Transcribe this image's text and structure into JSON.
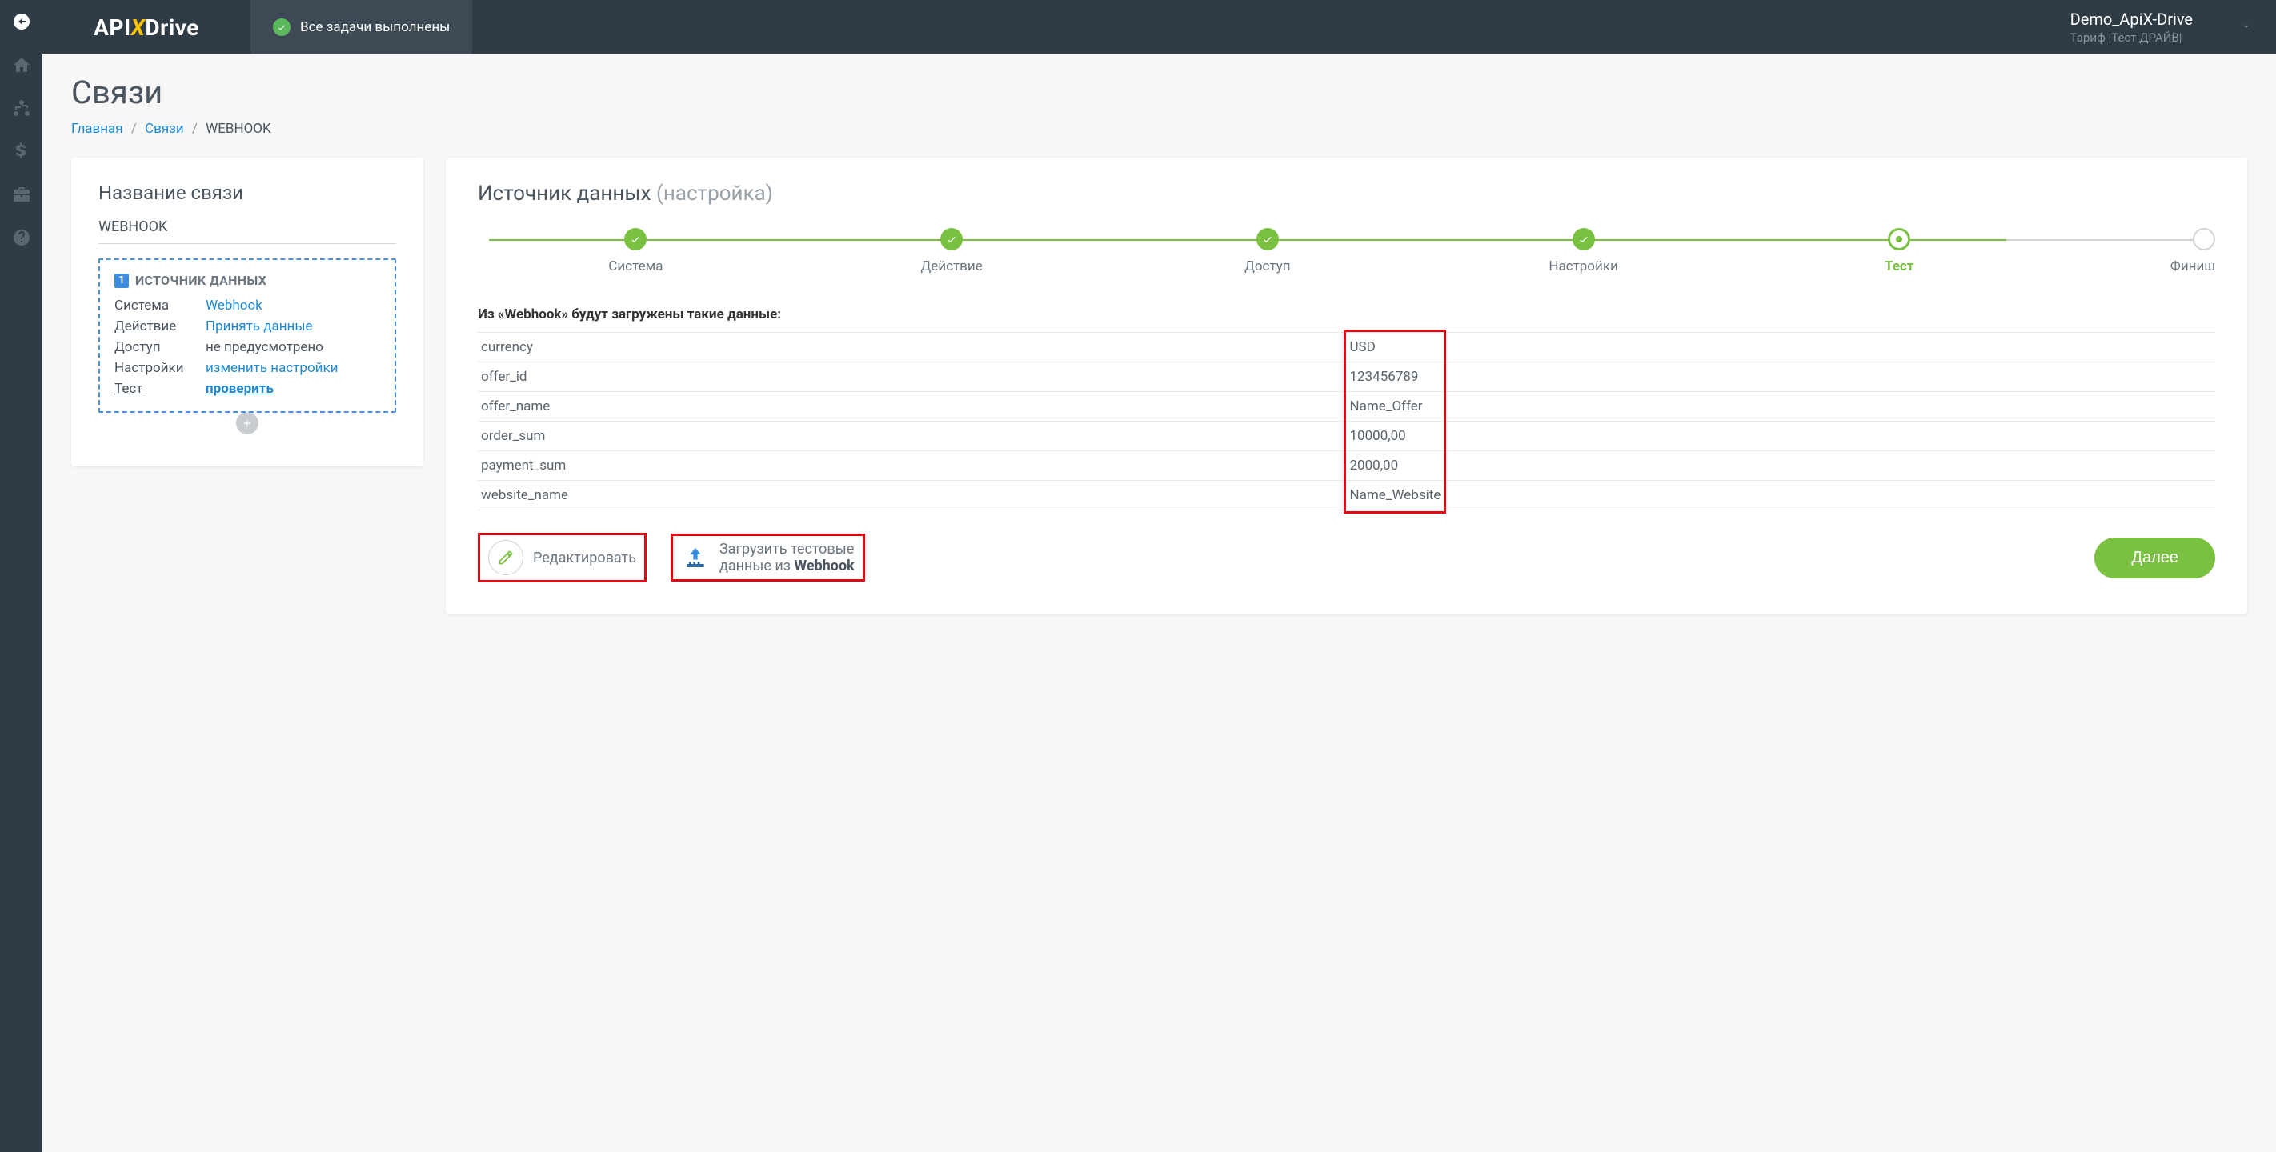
{
  "topbar": {
    "logo_pre": "API",
    "logo_x": "X",
    "logo_post": "Drive",
    "status": "Все задачи выполнены",
    "user_name": "Demo_ApiX-Drive",
    "user_plan": "Тариф |Тест ДРАЙВ|"
  },
  "page": {
    "title": "Связи"
  },
  "breadcrumb": {
    "home": "Главная",
    "links": "Связи",
    "current": "WEBHOOK"
  },
  "left": {
    "heading": "Название связи",
    "conn_name": "WEBHOOK",
    "source_badge": "1",
    "source_title": "ИСТОЧНИК ДАННЫХ",
    "rows": {
      "system_lbl": "Система",
      "system_val": "Webhook",
      "action_lbl": "Действие",
      "action_val": "Принять данные",
      "access_lbl": "Доступ",
      "access_val": "не предусмотрено",
      "settings_lbl": "Настройки",
      "settings_val": "изменить настройки",
      "test_lbl": "Тест",
      "test_val": "проверить"
    }
  },
  "right": {
    "heading_main": "Источник данных",
    "heading_muted": "(настройка)",
    "steps": {
      "system": "Система",
      "action": "Действие",
      "access": "Доступ",
      "settings": "Настройки",
      "test": "Тест",
      "finish": "Финиш"
    },
    "data_heading": "Из «Webhook» будут загружены такие данные:",
    "table": [
      {
        "key": "currency",
        "value": "USD"
      },
      {
        "key": "offer_id",
        "value": "123456789"
      },
      {
        "key": "offer_name",
        "value": "Name_Offer"
      },
      {
        "key": "order_sum",
        "value": "10000,00"
      },
      {
        "key": "payment_sum",
        "value": "2000,00"
      },
      {
        "key": "website_name",
        "value": "Name_Website"
      }
    ],
    "edit_label": "Редактировать",
    "load_label_1": "Загрузить тестовые",
    "load_label_2": "данные из ",
    "load_label_bold": "Webhook",
    "next_label": "Далее"
  }
}
